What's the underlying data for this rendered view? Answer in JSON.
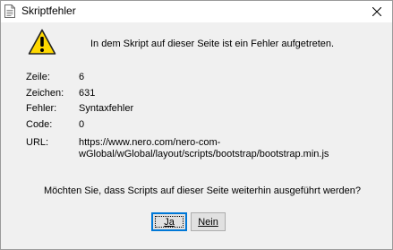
{
  "window": {
    "title": "Skriptfehler"
  },
  "message": "In dem Skript auf dieser Seite ist ein Fehler aufgetreten.",
  "details": {
    "line_label": "Zeile:",
    "line_value": "6",
    "char_label": "Zeichen:",
    "char_value": "631",
    "error_label": "Fehler:",
    "error_value": "Syntaxfehler",
    "code_label": "Code:",
    "code_value": "0",
    "url_label": "URL:",
    "url_value_line1": "https://www.nero.com/nero-com-",
    "url_value_line2": "wGlobal/wGlobal/layout/scripts/bootstrap/bootstrap.min.js"
  },
  "question": "Möchten Sie, dass Scripts auf dieser Seite weiterhin ausgeführt werden?",
  "buttons": {
    "yes_label": "Ja",
    "no_label": "Nein"
  },
  "icons": {
    "title": "document-icon",
    "warning": "warning-icon",
    "close": "close-icon"
  },
  "colors": {
    "warning_fill": "#ffd800",
    "focus_border": "#0078d7"
  }
}
